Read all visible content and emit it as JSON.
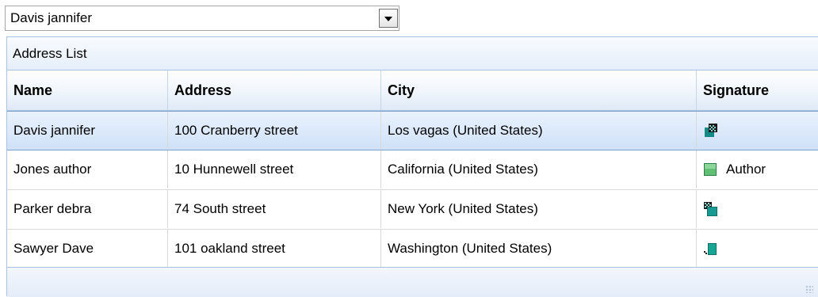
{
  "combo": {
    "selected": "Davis jannifer"
  },
  "grid": {
    "caption": "Address List",
    "columns": [
      "Name",
      "Address",
      "City",
      "Signature"
    ],
    "rows": [
      {
        "name": "Davis jannifer",
        "address": "100 Cranberry street",
        "city": "Los vagas (United States)",
        "signature_icon": "signature-scribble-icon-1",
        "signature_text": ""
      },
      {
        "name": "Jones author",
        "address": "10 Hunnewell street",
        "city": "California (United States)",
        "signature_icon": "green-square-icon",
        "signature_text": "Author"
      },
      {
        "name": "Parker debra",
        "address": "74 South street",
        "city": "New York (United States)",
        "signature_icon": "signature-scribble-icon-2",
        "signature_text": ""
      },
      {
        "name": "Sawyer Dave",
        "address": "101 oakland street",
        "city": "Washington (United States)",
        "signature_icon": "signature-scribble-icon-3",
        "signature_text": ""
      }
    ],
    "selected_row": 0
  },
  "colors": {
    "selection": "#cfe1f8",
    "border": "#a9c2e0",
    "icon_green": "#3aa05a",
    "icon_teal": "#148a84"
  }
}
